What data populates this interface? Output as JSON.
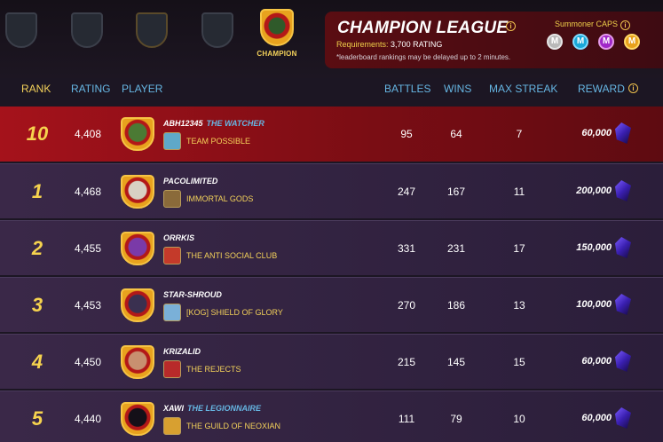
{
  "leagues": {
    "champion_label": "CHAMPION"
  },
  "league_panel": {
    "title": "CHAMPION LEAGUE",
    "requirements_label": "Requirements:",
    "requirements_value": "3,700 RATING",
    "note": "*leaderboard rankings may be delayed up to 2 minutes.",
    "caps_label": "Summoner CAPS",
    "caps": [
      "M",
      "M",
      "M",
      "M"
    ]
  },
  "columns": {
    "rank": "RANK",
    "rating": "RATING",
    "player": "PLAYER",
    "battles": "BATTLES",
    "wins": "WINS",
    "max_streak": "MAX STREAK",
    "reward": "REWARD"
  },
  "rows": [
    {
      "rank": "10",
      "rating": "4,408",
      "name": "ABH12345",
      "title": "THE WATCHER",
      "guild": "TEAM POSSIBLE",
      "battles": "95",
      "wins": "64",
      "max_streak": "7",
      "reward": "60,000",
      "highlight": true
    },
    {
      "rank": "1",
      "rating": "4,468",
      "name": "PACOLIMITED",
      "title": "",
      "guild": "IMMORTAL GODS",
      "battles": "247",
      "wins": "167",
      "max_streak": "11",
      "reward": "200,000"
    },
    {
      "rank": "2",
      "rating": "4,455",
      "name": "ORRKIS",
      "title": "",
      "guild": "THE ANTI SOCIAL CLUB",
      "battles": "331",
      "wins": "231",
      "max_streak": "17",
      "reward": "150,000"
    },
    {
      "rank": "3",
      "rating": "4,453",
      "name": "STAR-SHROUD",
      "title": "",
      "guild": "[KOG] SHIELD OF GLORY",
      "battles": "270",
      "wins": "186",
      "max_streak": "13",
      "reward": "100,000"
    },
    {
      "rank": "4",
      "rating": "4,450",
      "name": "KRIZALID",
      "title": "",
      "guild": "THE REJECTS",
      "battles": "215",
      "wins": "145",
      "max_streak": "15",
      "reward": "60,000"
    },
    {
      "rank": "5",
      "rating": "4,440",
      "name": "XAWI",
      "title": "THE LEGIONNAIRE",
      "guild": "THE GUILD OF NEOXIAN",
      "battles": "111",
      "wins": "79",
      "max_streak": "10",
      "reward": "60,000"
    }
  ],
  "icons": {
    "info": "info-icon",
    "reward": "credits-crystal-icon"
  }
}
